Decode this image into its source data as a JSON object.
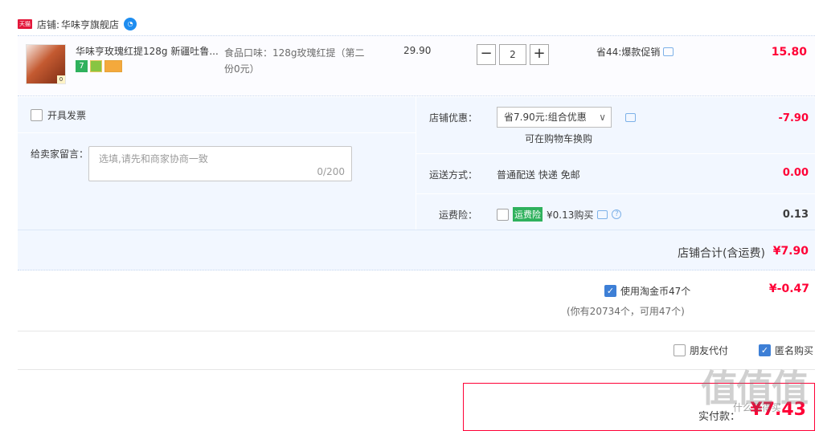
{
  "store": {
    "label": "店铺:",
    "name": "华味亨旗舰店",
    "logo": "天猫"
  },
  "item": {
    "title": "华味亨玫瑰红提128g 新疆吐鲁...",
    "sku": "食品口味：128g玫瑰红提（第二份0元）",
    "price": "29.90",
    "qty": "2",
    "badge7": "7",
    "thumb_qty": "0",
    "promo": "省44:爆款促销",
    "subtotal": "15.80"
  },
  "options": {
    "invoice_label": "开具发票",
    "message_label": "给卖家留言：",
    "message_placeholder": "选填,请先和商家协商一致",
    "message_count": "0/200",
    "discount_label": "店铺优惠：",
    "discount_select": "省7.90元:组合优惠",
    "discount_note": "可在购物车换购",
    "discount_value": "-7.90",
    "shipping_label": "运送方式：",
    "shipping_text": "普通配送 快递 免邮",
    "shipping_value": "0.00",
    "insurance_label": "运费险：",
    "insurance_badge": "运费险",
    "insurance_text": "¥0.13购买",
    "insurance_value": "0.13",
    "store_total_label": "店铺合计(含运费)",
    "store_total_value": "¥7.90"
  },
  "coins": {
    "label": "使用淘金币47个",
    "value": "¥-0.47",
    "note": "(你有20734个，可用47个)"
  },
  "extras": {
    "friend_pay": "朋友代付",
    "anonymous": "匿名购买"
  },
  "payment": {
    "label": "实付款：",
    "value": "¥7.43"
  },
  "watermark": {
    "text": "值值值",
    "sub": "什么值得买"
  },
  "colors": {
    "accent": "#ff0036",
    "panel": "#f2f7ff",
    "check": "#3d7fd6"
  }
}
